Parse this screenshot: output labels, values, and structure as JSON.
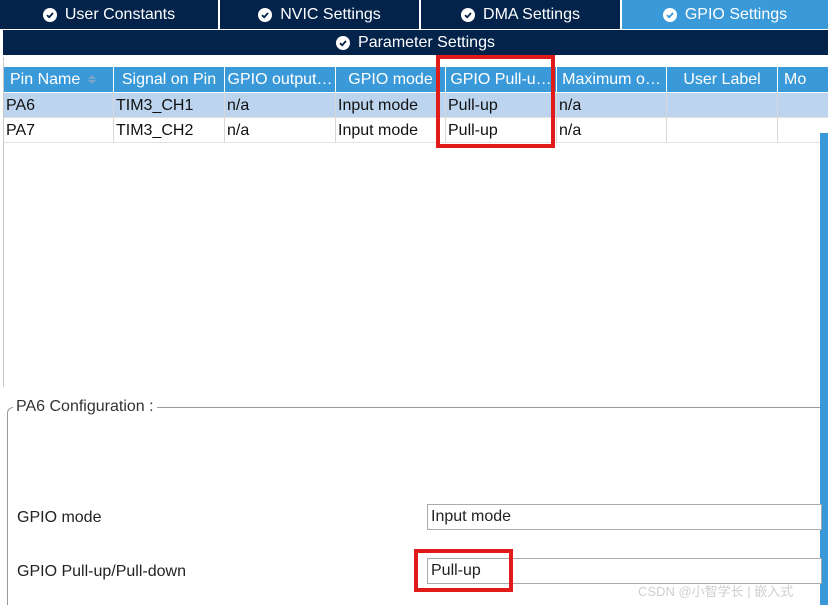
{
  "tabs": [
    {
      "label": "User Constants",
      "active": false,
      "icon": "check-circle-icon"
    },
    {
      "label": "NVIC Settings",
      "active": false,
      "icon": "check-circle-icon"
    },
    {
      "label": "DMA Settings",
      "active": false,
      "icon": "check-circle-icon"
    },
    {
      "label": "GPIO Settings",
      "active": true,
      "icon": "check-circle-icon"
    }
  ],
  "subtab": {
    "label": "Parameter Settings",
    "icon": "check-circle-icon"
  },
  "table": {
    "columns": [
      "Pin Name",
      "Signal on Pin",
      "GPIO output…",
      "GPIO mode",
      "GPIO Pull-u…",
      "Maximum o…",
      "User Label",
      "Mo"
    ],
    "rows": [
      {
        "cells": [
          "PA6",
          "TIM3_CH1",
          "n/a",
          "Input mode",
          "Pull-up",
          "n/a",
          "",
          ""
        ],
        "selected": true
      },
      {
        "cells": [
          "PA7",
          "TIM3_CH2",
          "n/a",
          "Input mode",
          "Pull-up",
          "n/a",
          "",
          ""
        ],
        "selected": false
      }
    ]
  },
  "config": {
    "title": "PA6 Configuration :",
    "gpio_mode_label": "GPIO mode",
    "gpio_mode_value": "Input mode",
    "pull_label": "GPIO Pull-up/Pull-down",
    "pull_value": "Pull-up"
  },
  "watermark": "CSDN @小智学长 | 嵌入式",
  "colors": {
    "tab_dark": "#03234b",
    "tab_active": "#3a9ad9",
    "highlight": "#e11a1a",
    "row_selected": "#bcd4ee"
  }
}
